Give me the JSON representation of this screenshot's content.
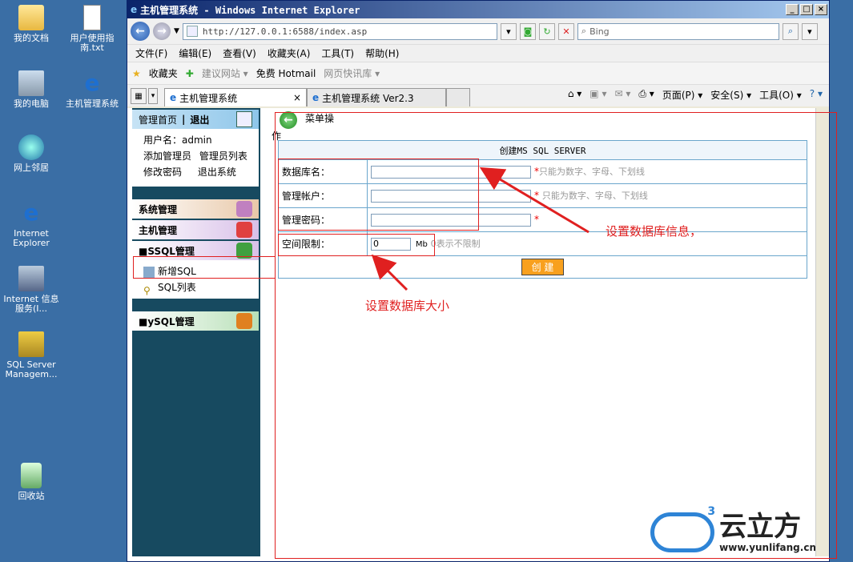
{
  "desktop": {
    "icons": [
      {
        "label": "我的文档"
      },
      {
        "label": "用户使用指南.txt"
      },
      {
        "label": "我的电脑"
      },
      {
        "label": "主机管理系统"
      },
      {
        "label": "网上邻居"
      },
      {
        "label": "Internet Explorer"
      },
      {
        "label": "Internet 信息服务(I..."
      },
      {
        "label": "SQL Server Managem..."
      },
      {
        "label": "回收站"
      }
    ]
  },
  "window": {
    "title": "主机管理系统 - Windows Internet Explorer",
    "controls": [
      "_",
      "□",
      "×"
    ]
  },
  "addressbar": {
    "url": "http://127.0.0.1:6588/index.asp",
    "search_placeholder": "Bing"
  },
  "menubar": [
    "文件(F)",
    "编辑(E)",
    "查看(V)",
    "收藏夹(A)",
    "工具(T)",
    "帮助(H)"
  ],
  "favbar": {
    "favorites": "收藏夹",
    "items": [
      {
        "label": "建议网站 ▾",
        "gray": true
      },
      {
        "label": "免费 Hotmail",
        "gray": false
      },
      {
        "label": "网页快讯库 ▾",
        "gray": true
      }
    ]
  },
  "tabs": [
    {
      "label": "主机管理系统",
      "close": "×"
    },
    {
      "label": "主机管理系统 Ver2.3"
    }
  ],
  "tools": [
    "页面(P) ▾",
    "安全(S) ▾",
    "工具(O) ▾"
  ],
  "sidebar": {
    "top_links": [
      "管理首页",
      "|",
      "退出"
    ],
    "username_label": "用户名：admin",
    "links": [
      [
        "添加管理员",
        "管理员列表"
      ],
      [
        "修改密码",
        "退出系统"
      ]
    ],
    "sections": [
      {
        "label": "系统管理",
        "color": "#e8c8a8",
        "icon_color": "#c080c0"
      },
      {
        "label": "主机管理",
        "color": "#d8c0e8",
        "icon_color": "#e04040"
      },
      {
        "label": "■SSQL管理",
        "color": "#d8c0e8",
        "icon_color": "#40a040"
      }
    ],
    "sql_items": [
      "新增SQL",
      "SQL列表"
    ],
    "mysql": {
      "label": "■ySQL管理",
      "color": "#b8e0b8",
      "icon_color": "#e08020"
    }
  },
  "main": {
    "menu_label": "菜单操",
    "menu_label2": "作",
    "form_caption": "创建MS SQL SERVER",
    "fields": [
      {
        "label": "数据库名：",
        "hint": "只能为数字、字母、下划线"
      },
      {
        "label": "管理帐户：",
        "hint": "只能为数字、字母、下划线"
      },
      {
        "label": "管理密码：",
        "hint": ""
      }
    ],
    "space": {
      "label": "空间限制：",
      "value": "0",
      "unit": "Mb",
      "hint": "0表示不限制"
    },
    "create_button": "创 建",
    "required": "*"
  },
  "annotations": {
    "db_info": "设置数据库信息，",
    "db_size": "设置数据库大小"
  },
  "watermark": {
    "brand": "云立方",
    "url": "www.yunlifang.cn",
    "superscript": "3"
  }
}
